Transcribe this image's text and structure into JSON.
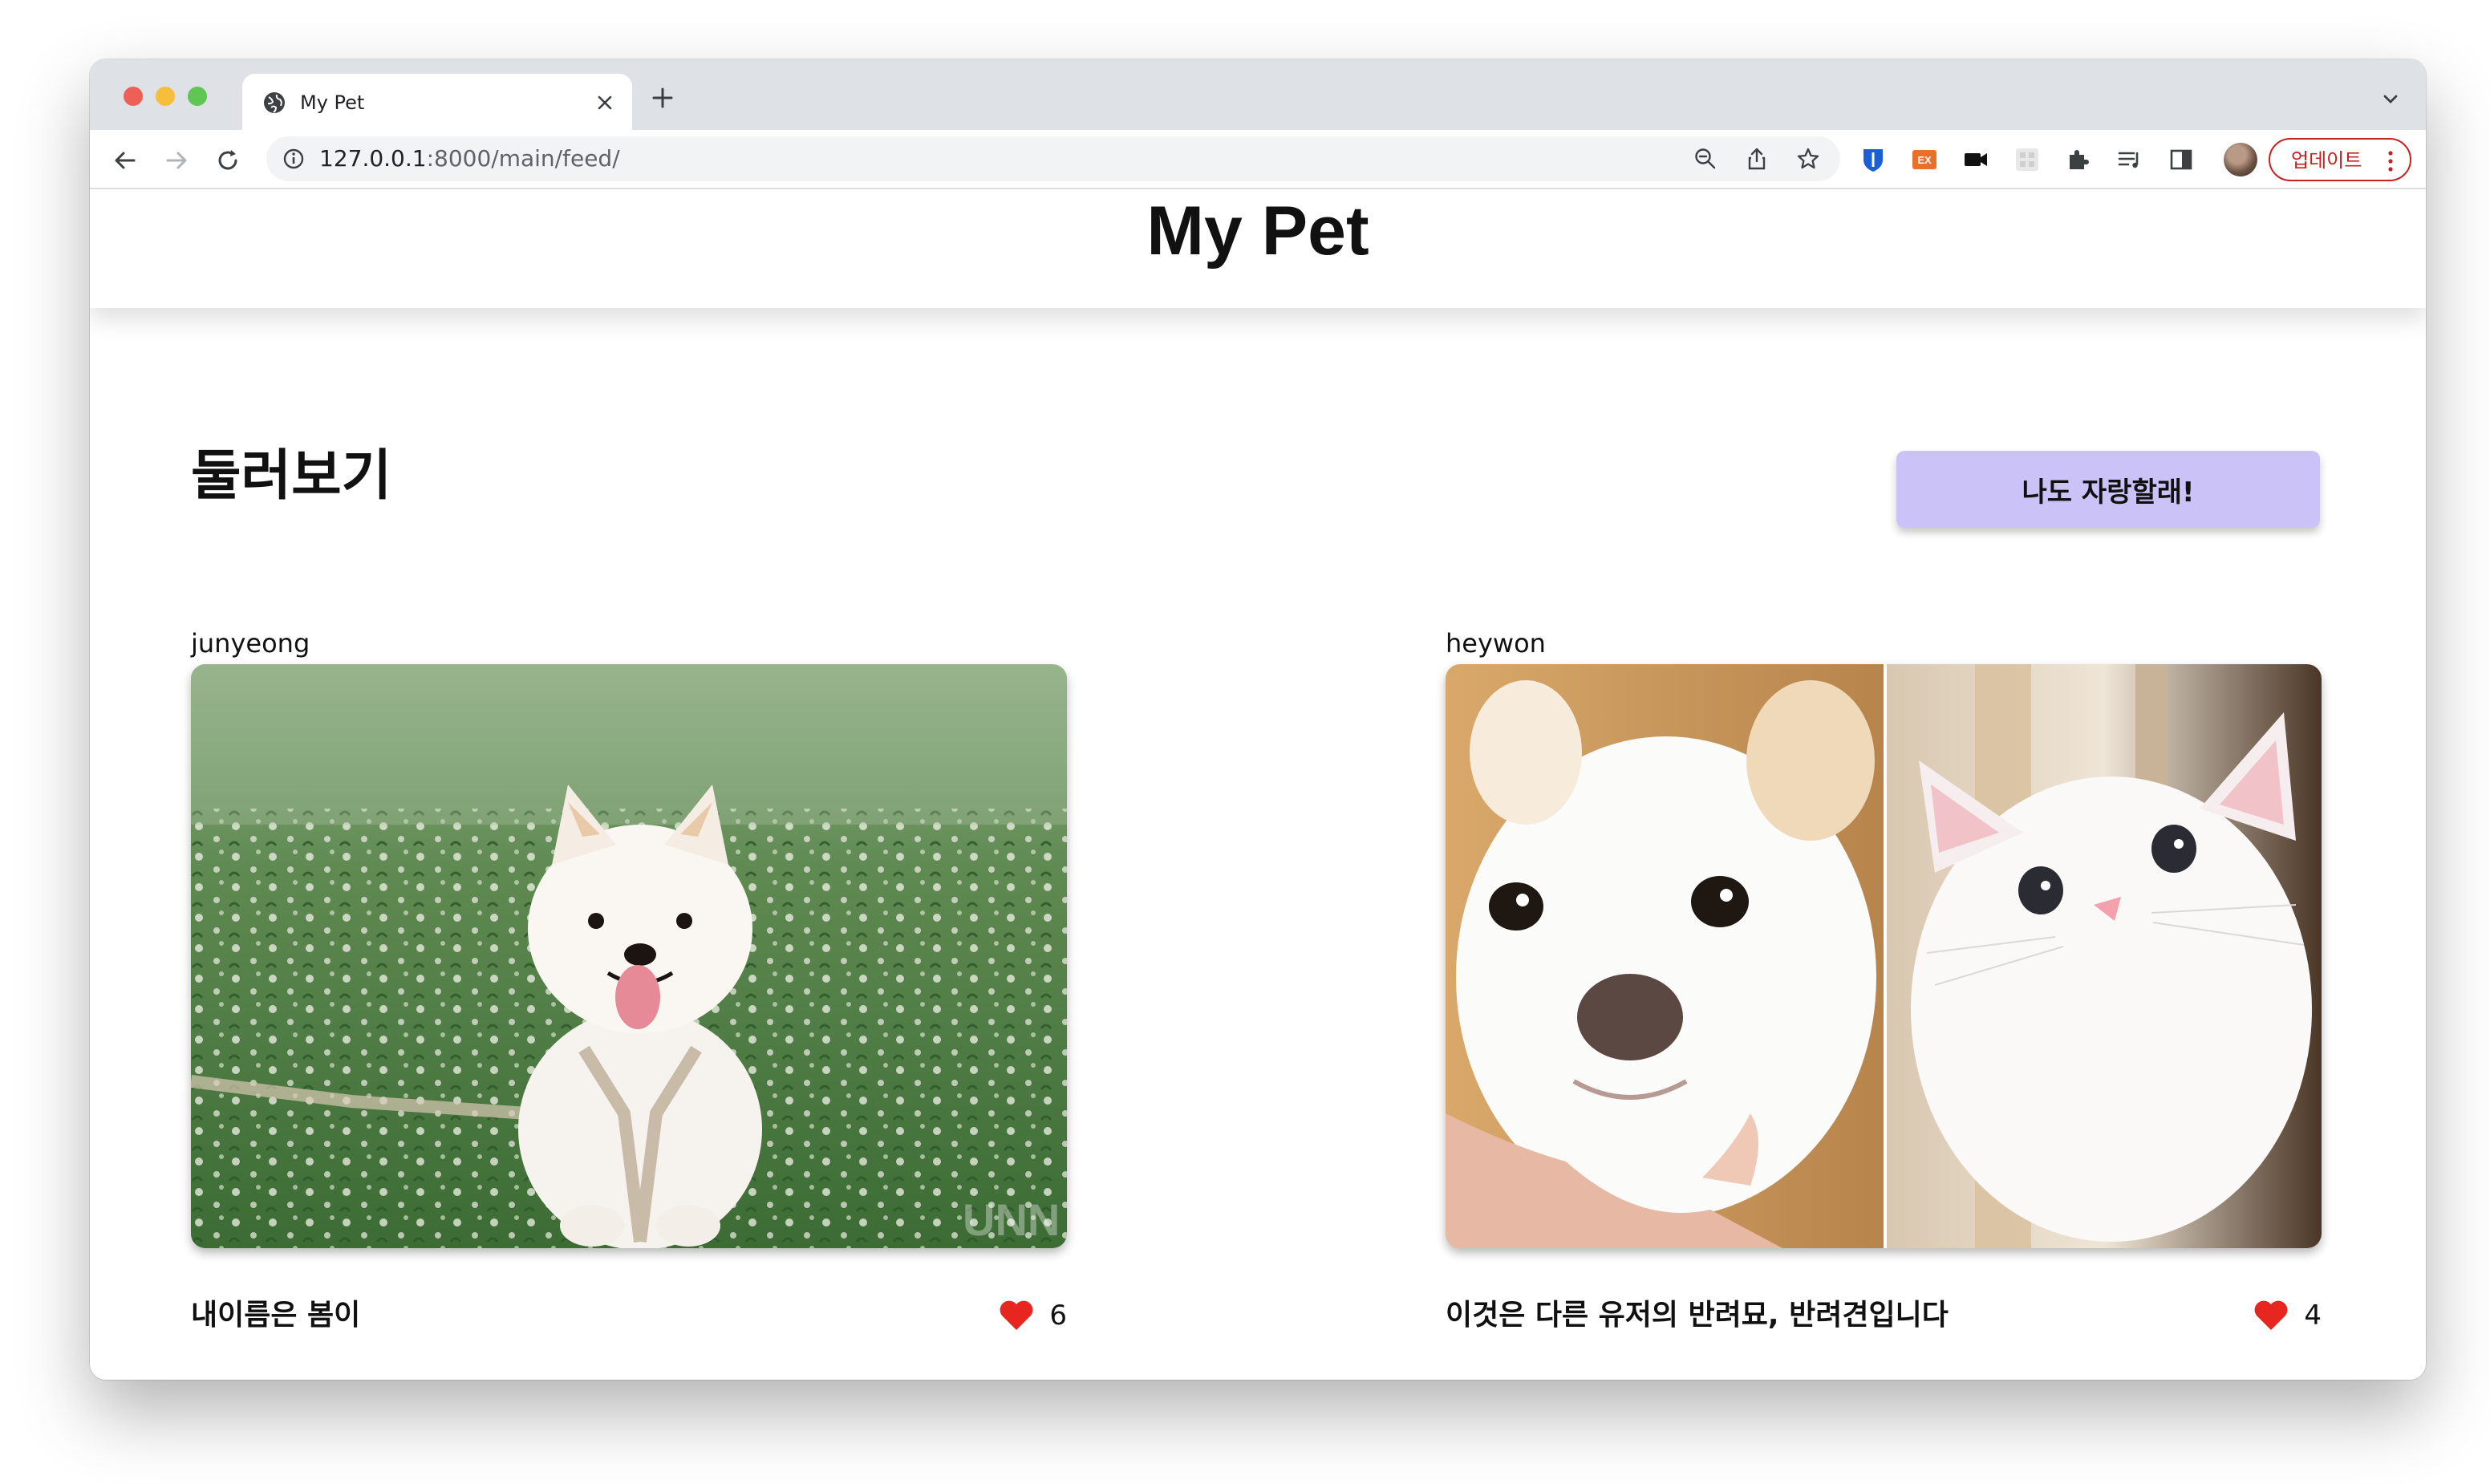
{
  "browser": {
    "tab": {
      "title": "My Pet"
    },
    "address": {
      "host": "127.0.0.1",
      "path": ":8000/main/feed/"
    },
    "update_label": "업데이트",
    "extensions": [
      "bitwarden-icon",
      "ex-extension-icon",
      "camera-extension-icon",
      "qr-extension-icon",
      "puzzle-icon",
      "reading-list-icon",
      "side-panel-icon"
    ]
  },
  "site": {
    "title": "My Pet"
  },
  "main": {
    "section_title": "둘러보기",
    "brag_button": "나도 자랑할래!"
  },
  "feed": [
    {
      "user": "junyeong",
      "caption": "내이름은 봄이",
      "likes": "6",
      "image": "white-pomeranian-in-clover-field"
    },
    {
      "user": "heywon",
      "caption": "이것은 다른 유저의 반려묘, 반려견입니다",
      "likes": "4",
      "image": "white-puppy-and-white-kitten"
    }
  ],
  "colors": {
    "brag_button": "#cbc3f8",
    "heart": "#e6261f",
    "update": "#c5221f"
  }
}
